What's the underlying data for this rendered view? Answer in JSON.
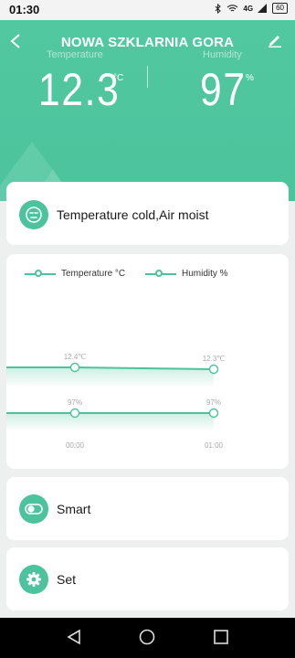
{
  "status_bar": {
    "time": "01:30",
    "network": "4G",
    "battery": "60"
  },
  "header": {
    "title": "NOWA SZKLARNIA GORA",
    "temperature_label": "Temperature",
    "temperature_value": "12.3",
    "temperature_unit": "°C",
    "humidity_label": "Humidity",
    "humidity_value": "97",
    "humidity_unit": "%",
    "accent_color": "#4cc39c"
  },
  "status_card": {
    "icon": "face-icon",
    "text": "Temperature cold,Air moist"
  },
  "chart": {
    "legend": [
      "Temperature °C",
      "Humidity %"
    ],
    "x_ticks": [
      "00:00",
      "01:00"
    ]
  },
  "chart_data": {
    "type": "line",
    "x": [
      "00:00",
      "01:00"
    ],
    "series": [
      {
        "name": "Temperature °C",
        "values": [
          12.4,
          12.3
        ],
        "labels": [
          "12.4℃",
          "12.3℃"
        ]
      },
      {
        "name": "Humidity %",
        "values": [
          97,
          97
        ],
        "labels": [
          "97%",
          "97%"
        ]
      }
    ],
    "title": "",
    "xlabel": "",
    "ylabel": ""
  },
  "modes": [
    {
      "label": "Smart",
      "icon": "toggle-icon"
    },
    {
      "label": "Set",
      "icon": "gear-icon"
    }
  ],
  "nav": {
    "back": "back-icon",
    "home": "home-icon",
    "recents": "recents-icon"
  }
}
